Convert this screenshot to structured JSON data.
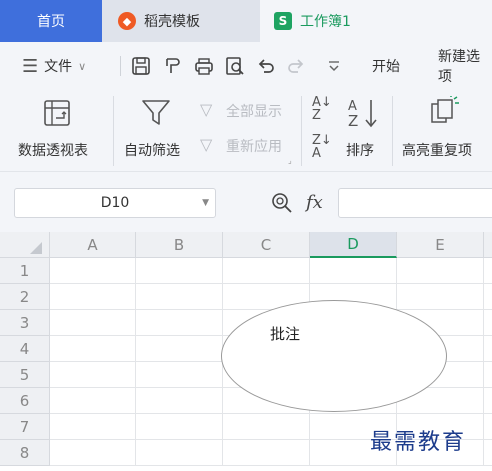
{
  "tabs": {
    "home": "首页",
    "template": "稻壳模板",
    "workbook": "工作簿1",
    "sheet_icon_letter": "S"
  },
  "menu": {
    "file": "文件",
    "start": "开始",
    "new_tab": "新建选项"
  },
  "ribbon": {
    "pivot": "数据透视表",
    "autofilter": "自动筛选",
    "show_all": "全部显示",
    "reapply": "重新应用",
    "sort": "排序",
    "highlight_dup": "高亮重复项"
  },
  "formula": {
    "cell_ref": "D10",
    "fx": "fx",
    "value": ""
  },
  "grid": {
    "columns": [
      "A",
      "B",
      "C",
      "D",
      "E"
    ],
    "rows": [
      "1",
      "2",
      "3",
      "4",
      "5",
      "6",
      "7",
      "8"
    ],
    "active_column": "D"
  },
  "comment": {
    "text": "批注"
  },
  "watermark": "最需教育",
  "colors": {
    "accent_blue": "#3f6fdc",
    "sheet_green": "#1a9a5e",
    "template_orange": "#ef5a24"
  }
}
